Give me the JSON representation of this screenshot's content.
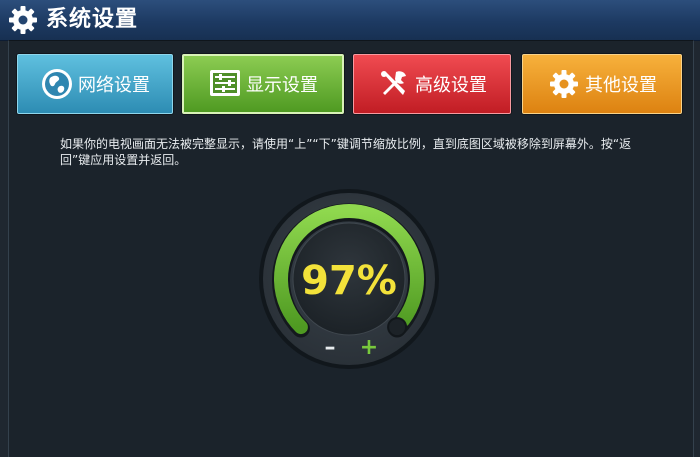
{
  "window": {
    "title": "系统设置",
    "title_icon": "gear-icon"
  },
  "tabs": [
    {
      "id": "network",
      "label": "网络设置",
      "icon": "globe-icon",
      "color": "#3aa3c9"
    },
    {
      "id": "display",
      "label": "显示设置",
      "icon": "display-sliders-icon",
      "color": "#6db33a",
      "selected": true
    },
    {
      "id": "advanced",
      "label": "高级设置",
      "icon": "tools-icon",
      "color": "#e3333a"
    },
    {
      "id": "other",
      "label": "其他设置",
      "icon": "gear-icon",
      "color": "#f2a12d"
    }
  ],
  "instructions": "如果你的电视画面无法被完整显示，请使用“上”“下”键调节缩放比例，直到底图区域被移除到屏幕外。按“返回”键应用设置并返回。",
  "zoom_dial": {
    "value_text": "97%",
    "value": 97,
    "minus_label": "–",
    "plus_label": "+",
    "value_color": "#f3e23a",
    "arc_color": "#6fc23a"
  }
}
